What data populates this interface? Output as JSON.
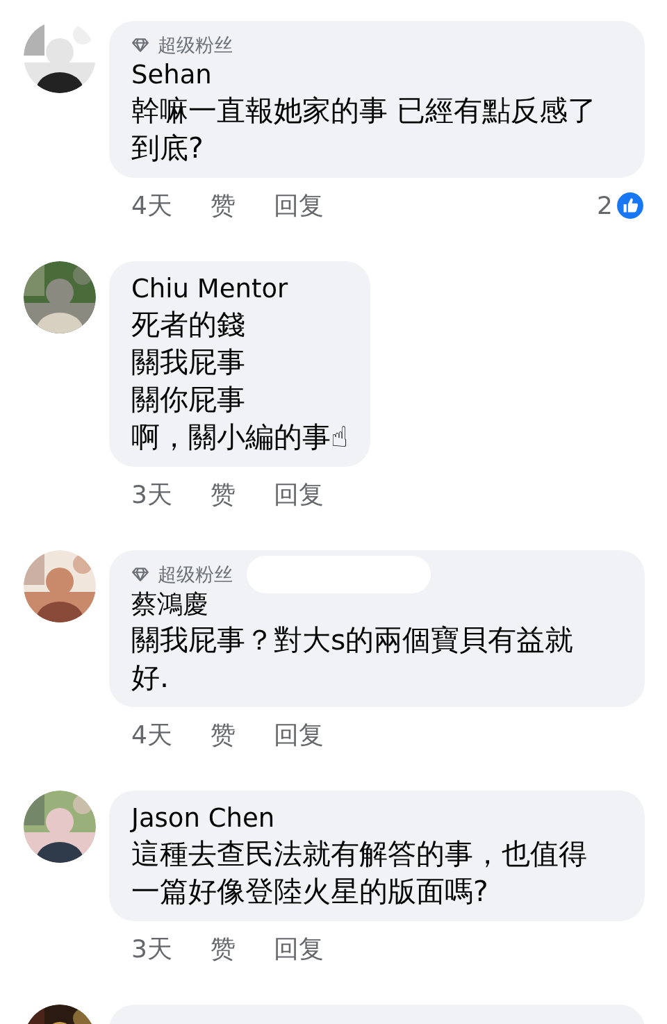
{
  "comments": [
    {
      "badge": "超级粉丝",
      "redacted": false,
      "author": "Sehan",
      "lines": [
        "幹嘛一直報她家的事 已經有點反感了",
        "到底?"
      ],
      "time": "4天",
      "like": "赞",
      "reply": "回复",
      "reaction_count": "2",
      "wide": true
    },
    {
      "author": "Chiu Mentor",
      "lines": [
        "死者的錢",
        "關我屁事",
        "關你屁事",
        "啊，關小編的事☝"
      ],
      "time": "3天",
      "like": "赞",
      "reply": "回复",
      "wide": false
    },
    {
      "badge": "超级粉丝",
      "redacted": true,
      "author": "蔡鴻慶",
      "lines": [
        "關我屁事？對大s的兩個寶貝有益就",
        "好."
      ],
      "time": "4天",
      "like": "赞",
      "reply": "回复",
      "wide": true
    },
    {
      "author": "Jason Chen",
      "lines": [
        "這種去查民法就有解答的事，也值得",
        "一篇好像登陸火星的版面嗎?"
      ],
      "time": "3天",
      "like": "赞",
      "reply": "回复",
      "wide": true
    }
  ]
}
